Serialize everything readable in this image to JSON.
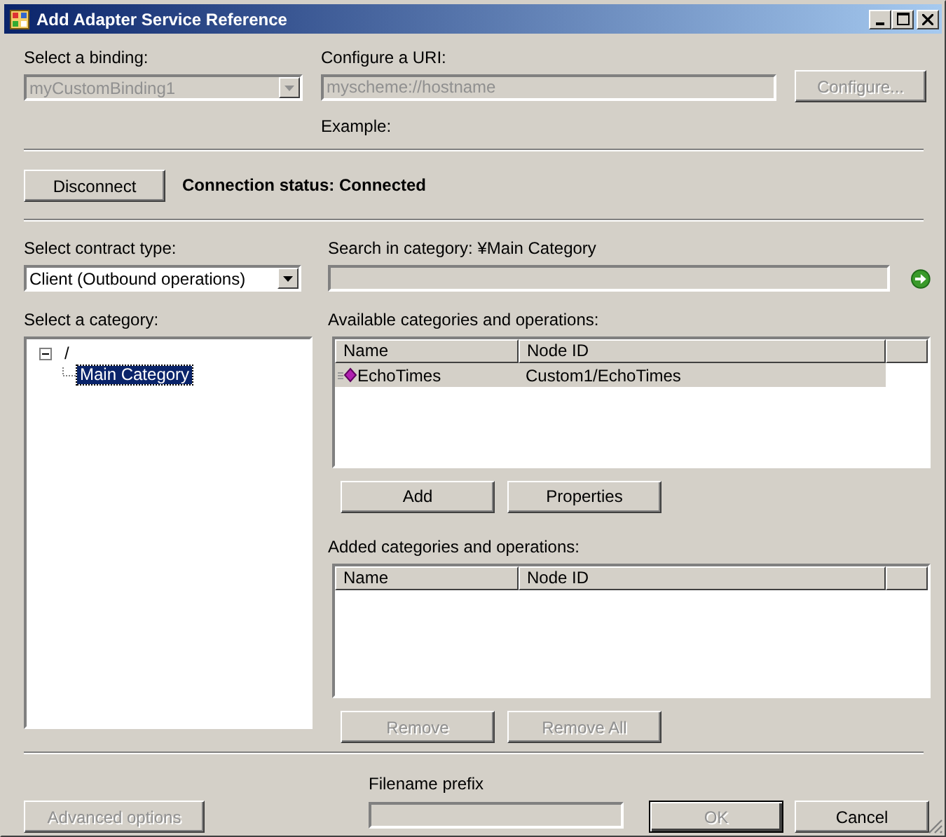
{
  "window": {
    "title": "Add Adapter Service Reference"
  },
  "binding": {
    "label": "Select a binding:",
    "value": "myCustomBinding1",
    "disabled": true
  },
  "uri": {
    "label": "Configure a URI:",
    "value": "myscheme://hostname",
    "disabled": true
  },
  "configure_button": {
    "label": "Configure...",
    "disabled": true
  },
  "example_label": "Example:",
  "disconnect_button": {
    "label": "Disconnect",
    "disabled": false
  },
  "connection_status": "Connection status: Connected",
  "contract": {
    "label": "Select contract type:",
    "value": "Client (Outbound operations)"
  },
  "search": {
    "label": "Search in category: ¥Main Category"
  },
  "category": {
    "label": "Select a category:",
    "tree": [
      {
        "label": "/",
        "expanded": true,
        "selected": false,
        "children": [
          {
            "label": "Main Category",
            "selected": true
          }
        ]
      }
    ]
  },
  "available": {
    "label": "Available categories and operations:",
    "columns": [
      "Name",
      "Node ID"
    ],
    "rows": [
      {
        "name": "EchoTimes",
        "node_id": "Custom1/EchoTimes",
        "selected": true
      }
    ]
  },
  "add_button": {
    "label": "Add",
    "disabled": false
  },
  "properties_button": {
    "label": "Properties",
    "disabled": false
  },
  "added": {
    "label": "Added categories and operations:",
    "columns": [
      "Name",
      "Node ID"
    ]
  },
  "remove_button": {
    "label": "Remove",
    "disabled": true
  },
  "remove_all_button": {
    "label": "Remove All",
    "disabled": true
  },
  "advanced_button": {
    "label": "Advanced options",
    "disabled": true
  },
  "filename": {
    "label": "Filename prefix"
  },
  "ok_button": {
    "label": "OK",
    "disabled": true
  },
  "cancel_button": {
    "label": "Cancel",
    "disabled": false
  }
}
